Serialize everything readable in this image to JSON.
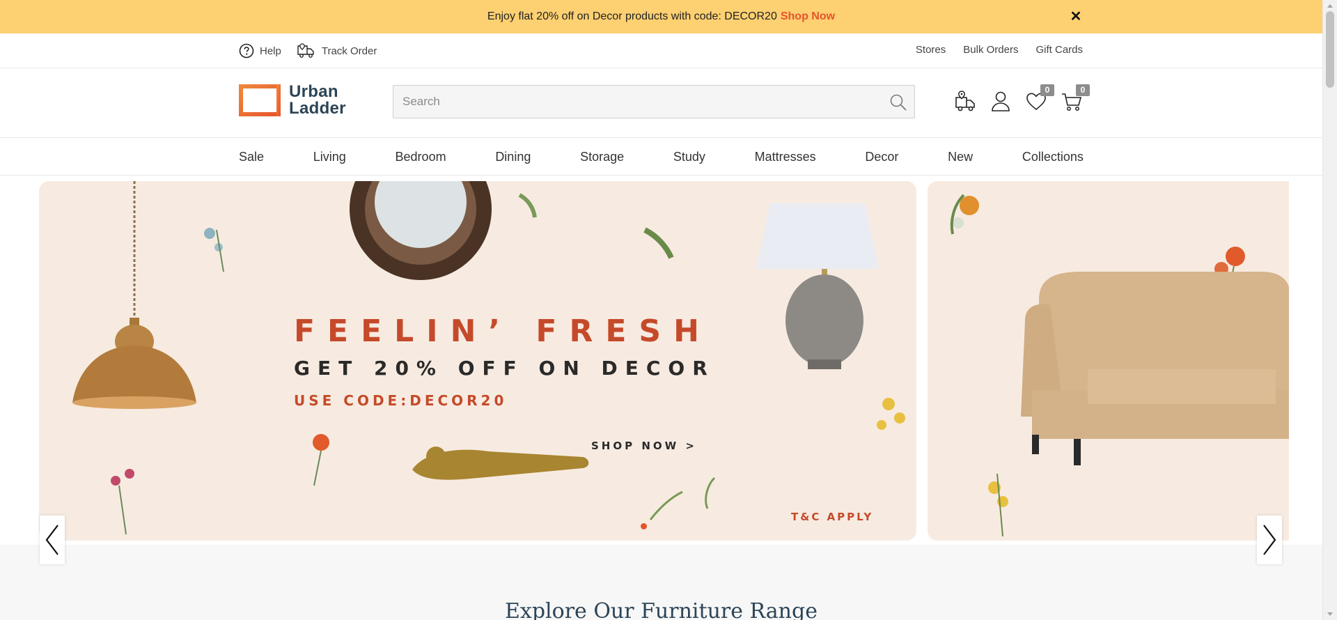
{
  "promo": {
    "text": "Enjoy flat 20% off on Decor products with code: DECOR20",
    "link": "Shop Now",
    "close": "✕"
  },
  "utility": {
    "help": "Help",
    "track_order": "Track Order",
    "right_links": [
      "Stores",
      "Bulk Orders",
      "Gift Cards"
    ]
  },
  "header": {
    "logo_line1": "Urban",
    "logo_line2": "Ladder",
    "search_placeholder": "Search",
    "wishlist_count": "0",
    "cart_count": "0"
  },
  "nav": {
    "items": [
      "Sale",
      "Living",
      "Bedroom",
      "Dining",
      "Storage",
      "Study",
      "Mattresses",
      "Decor",
      "New",
      "Collections"
    ]
  },
  "hero": {
    "headline": "FEELIN’ FRESH",
    "subline": "GET 20% OFF ON DECOR",
    "code": "USE CODE:DECOR20",
    "cta": "SHOP NOW >",
    "terms": "T&C APPLY"
  },
  "explore": {
    "title": "Explore Our Furniture Range"
  },
  "colors": {
    "promo_bg": "#fdd072",
    "accent": "#e6532c",
    "brand": "#2c4456",
    "hero_bg": "#f7ebe1"
  },
  "icons": [
    "help-icon",
    "truck-icon",
    "search-icon",
    "location-truck-icon",
    "user-icon",
    "heart-icon",
    "cart-icon",
    "chevron-left-icon",
    "chevron-right-icon",
    "close-icon"
  ]
}
